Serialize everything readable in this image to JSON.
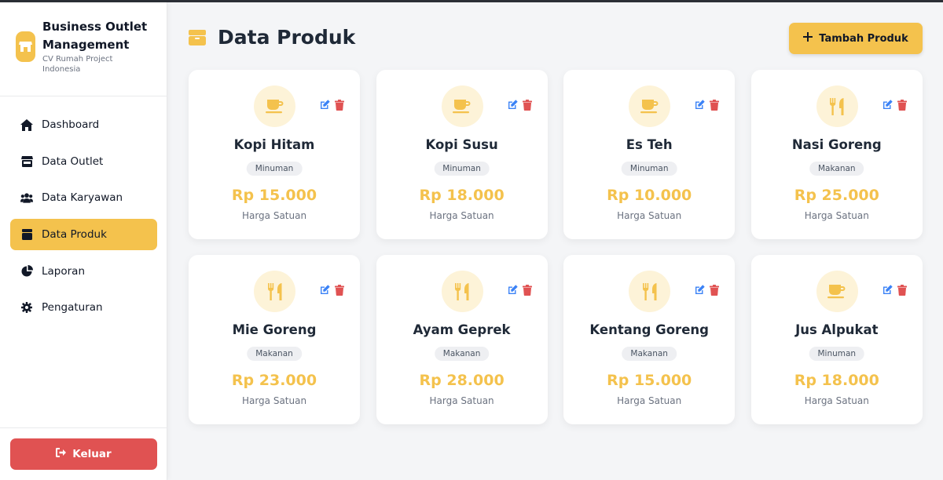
{
  "brand": {
    "title": "Business Outlet Management",
    "subtitle": "CV Rumah Project Indonesia"
  },
  "nav": [
    {
      "label": "Dashboard",
      "icon": "home-icon",
      "active": false
    },
    {
      "label": "Data Outlet",
      "icon": "store-icon",
      "active": false
    },
    {
      "label": "Data Karyawan",
      "icon": "users-icon",
      "active": false
    },
    {
      "label": "Data Produk",
      "icon": "box-icon",
      "active": true
    },
    {
      "label": "Laporan",
      "icon": "pie-chart-icon",
      "active": false
    },
    {
      "label": "Pengaturan",
      "icon": "gear-icon",
      "active": false
    }
  ],
  "logout_label": "Keluar",
  "page": {
    "title": "Data Produk",
    "add_button": "Tambah Produk"
  },
  "products": [
    {
      "name": "Kopi Hitam",
      "category": "Minuman",
      "price": "Rp 15.000",
      "unit": "Harga Satuan",
      "icon": "coffee-icon"
    },
    {
      "name": "Kopi Susu",
      "category": "Minuman",
      "price": "Rp 18.000",
      "unit": "Harga Satuan",
      "icon": "coffee-icon"
    },
    {
      "name": "Es Teh",
      "category": "Minuman",
      "price": "Rp 10.000",
      "unit": "Harga Satuan",
      "icon": "coffee-icon"
    },
    {
      "name": "Nasi Goreng",
      "category": "Makanan",
      "price": "Rp 25.000",
      "unit": "Harga Satuan",
      "icon": "utensils-icon"
    },
    {
      "name": "Mie Goreng",
      "category": "Makanan",
      "price": "Rp 23.000",
      "unit": "Harga Satuan",
      "icon": "utensils-icon"
    },
    {
      "name": "Ayam Geprek",
      "category": "Makanan",
      "price": "Rp 28.000",
      "unit": "Harga Satuan",
      "icon": "utensils-icon"
    },
    {
      "name": "Kentang Goreng",
      "category": "Makanan",
      "price": "Rp 15.000",
      "unit": "Harga Satuan",
      "icon": "utensils-icon"
    },
    {
      "name": "Jus Alpukat",
      "category": "Minuman",
      "price": "Rp 18.000",
      "unit": "Harga Satuan",
      "icon": "coffee-icon"
    }
  ],
  "colors": {
    "accent": "#f4c24d",
    "danger": "#e05252",
    "edit": "#3b82f6",
    "accent_soft": "#fdf3d8"
  }
}
